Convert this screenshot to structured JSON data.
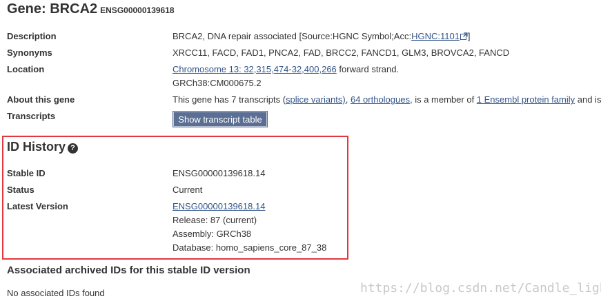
{
  "gene": {
    "title": "Gene: BRCA2",
    "id": "ENSG00000139618"
  },
  "summary": {
    "description": {
      "label": "Description",
      "text": "BRCA2, DNA repair associated [Source:HGNC Symbol;Acc:",
      "link": "HGNC:1101",
      "suffix": "]"
    },
    "synonyms": {
      "label": "Synonyms",
      "text": "XRCC11, FACD, FAD1, PNCA2, FAD, BRCC2, FANCD1, GLM3, BROVCA2, FANCD"
    },
    "location": {
      "label": "Location",
      "link": "Chromosome 13: 32,315,474-32,400,266",
      "strand": " forward strand.",
      "assembly": "GRCh38:CM000675.2"
    },
    "about": {
      "label": "About this gene",
      "p1": "This gene has 7 transcripts (",
      "link1": "splice variants)",
      "p2": ", ",
      "link2": "64 orthologues",
      "p3": ", is a member of ",
      "link3": "1 Ensembl protein family",
      "p4": " and is"
    },
    "transcripts": {
      "label": "Transcripts",
      "button": "Show transcript table"
    }
  },
  "id_history": {
    "title": "ID History",
    "stable_id_label": "Stable ID",
    "stable_id": "ENSG00000139618.14",
    "status_label": "Status",
    "status": "Current",
    "latest_label": "Latest Version",
    "latest_link": "ENSG00000139618.14",
    "release": "Release: 87 (current)",
    "assembly": "Assembly: GRCh38",
    "database": "Database: homo_sapiens_core_87_38",
    "highlight_color": "#e2373f"
  },
  "archived": {
    "title": "Associated archived IDs for this stable ID version",
    "empty": "No associated IDs found"
  },
  "watermark": "https://blog.csdn.net/Candle_light"
}
